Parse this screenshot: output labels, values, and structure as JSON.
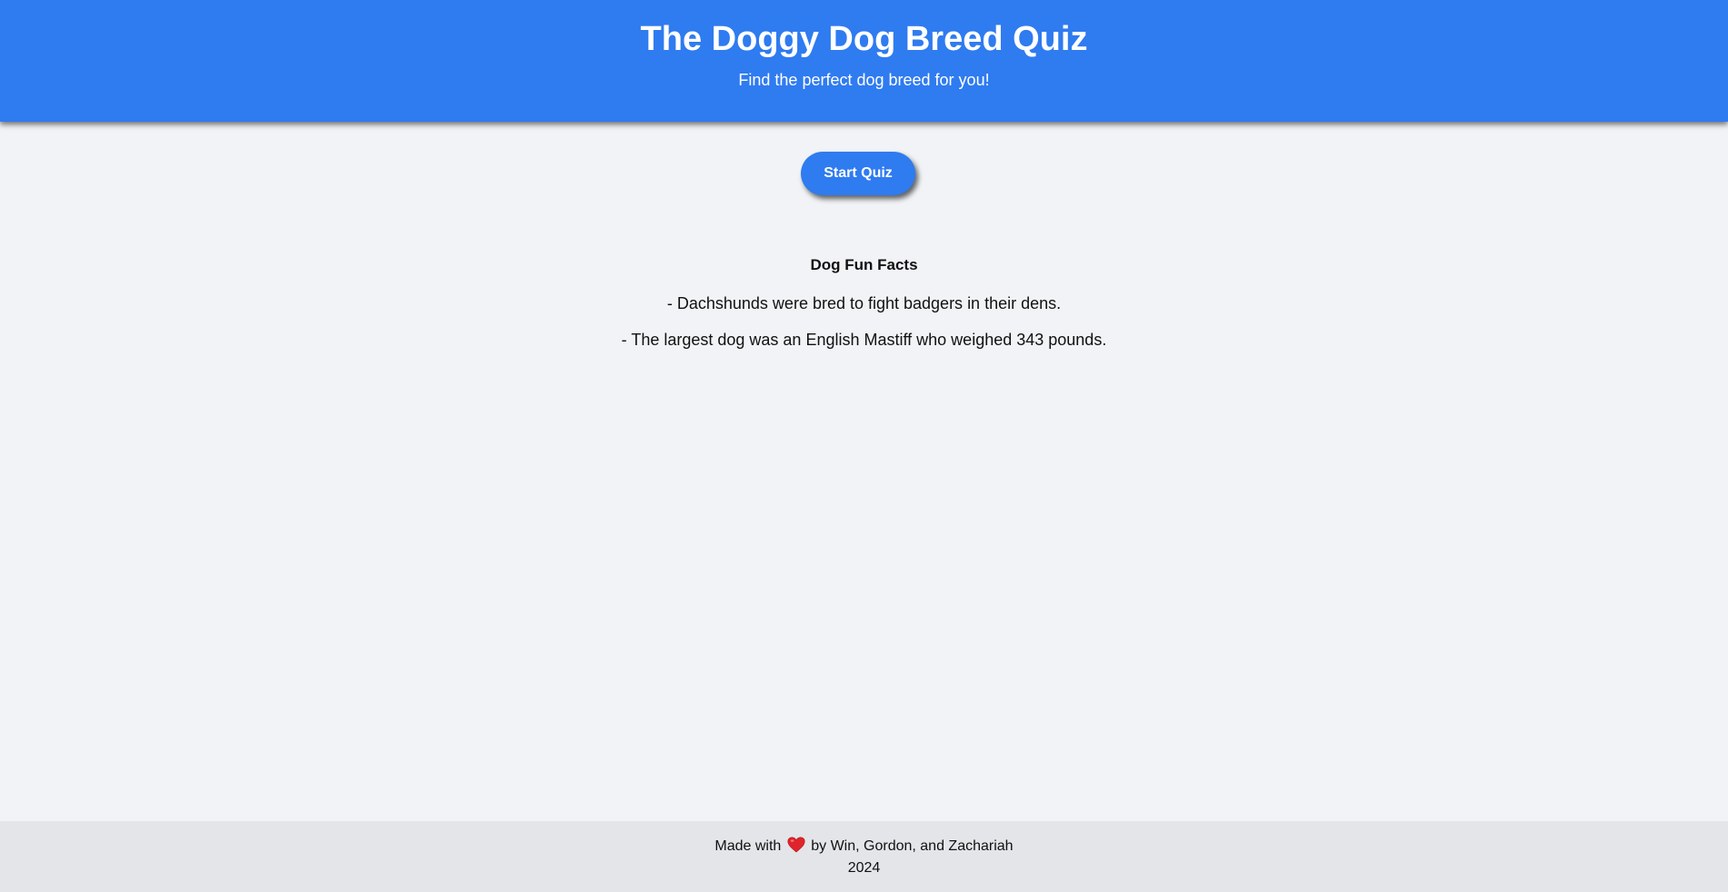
{
  "header": {
    "title": "The Doggy Dog Breed Quiz",
    "subtitle": "Find the perfect dog breed for you!",
    "background_color": "#2f7bf0"
  },
  "main": {
    "start_button_label": "Start Quiz",
    "fun_facts": {
      "title": "Dog Fun Facts",
      "items": [
        "- Dachshunds were bred to fight badgers in their dens.",
        "- The largest dog was an English Mastiff who weighed 343 pounds."
      ]
    }
  },
  "footer": {
    "made_with_prefix": "Made with",
    "heart_icon": "heart-icon",
    "made_with_suffix": "by Win, Gordon, and Zachariah",
    "year": "2024",
    "heart_color": "#e0242b"
  }
}
